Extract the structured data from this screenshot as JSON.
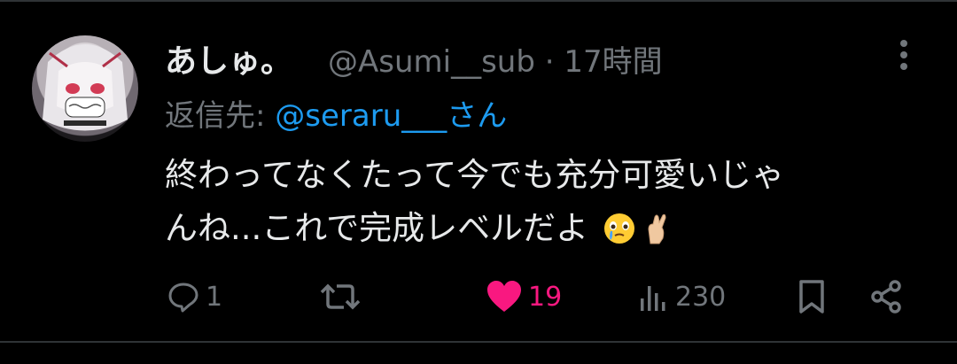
{
  "post": {
    "display_name": "あしゅ。",
    "handle_time": "@Asumi__sub · 17時間",
    "reply_label": "返信先: ",
    "reply_mention": "@seraru___さん",
    "body_line1": "終わってなくたって今でも充分可愛いじゃ",
    "body_line2": "んね...これで完成レベルだよ",
    "emojis": [
      "face-holding-back-tears-icon",
      "crossed-fingers-icon"
    ]
  },
  "actions": {
    "replies": "1",
    "retweets": "",
    "likes": "19",
    "views": "230"
  },
  "colors": {
    "background": "#000000",
    "text": "#e7e9ea",
    "muted": "#71767b",
    "link": "#1d9bf0",
    "like": "#f91880"
  }
}
